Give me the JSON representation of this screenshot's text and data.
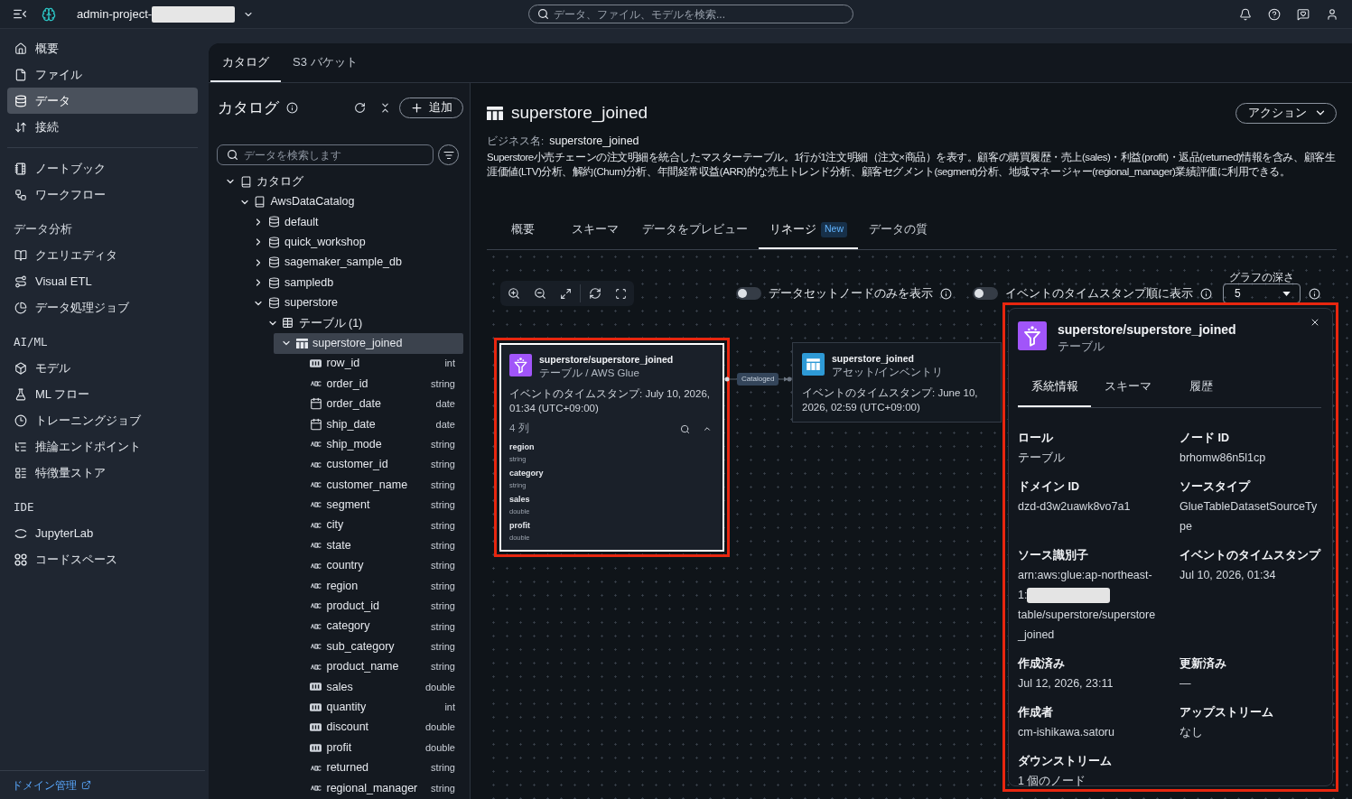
{
  "top_bar": {
    "project_name": "admin-project-",
    "project_name_redacted": true,
    "search": {
      "placeholder": "データ、ファイル、モデルを検索..."
    }
  },
  "sidebar": {
    "groups": [
      {
        "items": [
          {
            "label": "概要",
            "selected": false
          },
          {
            "label": "ファイル",
            "selected": false
          },
          {
            "label": "データ",
            "selected": true
          },
          {
            "label": "接続",
            "selected": false
          }
        ]
      },
      {
        "items": [
          {
            "label": "ノートブック",
            "selected": false
          },
          {
            "label": "ワークフロー",
            "selected": false
          }
        ]
      },
      {
        "heading": "データ分析",
        "items": [
          {
            "label": "クエリエディタ",
            "selected": false
          },
          {
            "label": "Visual ETL",
            "selected": false
          },
          {
            "label": "データ処理ジョブ",
            "selected": false
          }
        ]
      },
      {
        "heading": "AI/ML",
        "items": [
          {
            "label": "モデル",
            "selected": false
          },
          {
            "label": "ML フロー",
            "selected": false
          },
          {
            "label": "トレーニングジョブ",
            "selected": false
          },
          {
            "label": "推論エンドポイント",
            "selected": false
          },
          {
            "label": "特徴量ストア",
            "selected": false
          }
        ]
      },
      {
        "heading": "IDE",
        "items": [
          {
            "label": "JupyterLab",
            "selected": false
          },
          {
            "label": "コードスペース",
            "selected": false
          }
        ]
      }
    ],
    "footer_link": "ドメイン管理"
  },
  "main_tabs": [
    {
      "label": "カタログ",
      "selected": true
    },
    {
      "label": "S3 バケット",
      "selected": false
    }
  ],
  "catalog": {
    "title": "カタログ",
    "add_button": "追加",
    "search": {
      "placeholder": "データを検索します"
    },
    "tree": [
      {
        "label": "カタログ",
        "kind": "catalog",
        "expanded": true,
        "selected": false,
        "children": [
          {
            "label": "AwsDataCatalog",
            "kind": "catalog",
            "expanded": true,
            "selected": false,
            "children": [
              {
                "label": "default",
                "kind": "database",
                "expanded": false,
                "selected": false
              },
              {
                "label": "quick_workshop",
                "kind": "database",
                "expanded": false,
                "selected": false
              },
              {
                "label": "sagemaker_sample_db",
                "kind": "database",
                "expanded": false,
                "selected": false
              },
              {
                "label": "sampledb",
                "kind": "database",
                "expanded": false,
                "selected": false
              },
              {
                "label": "superstore",
                "kind": "database",
                "expanded": true,
                "selected": false,
                "children": [
                  {
                    "label": "テーブル (1)",
                    "kind": "folder",
                    "expanded": true,
                    "selected": false,
                    "children": [
                      {
                        "label": "superstore_joined",
                        "kind": "table",
                        "expanded": true,
                        "selected": true,
                        "children": [
                          {
                            "label": "row_id",
                            "kind": "number",
                            "data_type": "int",
                            "selected": false
                          },
                          {
                            "label": "order_id",
                            "kind": "text",
                            "data_type": "string",
                            "selected": false
                          },
                          {
                            "label": "order_date",
                            "kind": "date",
                            "data_type": "date",
                            "selected": false
                          },
                          {
                            "label": "ship_date",
                            "kind": "date",
                            "data_type": "date",
                            "selected": false
                          },
                          {
                            "label": "ship_mode",
                            "kind": "text",
                            "data_type": "string",
                            "selected": false
                          },
                          {
                            "label": "customer_id",
                            "kind": "text",
                            "data_type": "string",
                            "selected": false
                          },
                          {
                            "label": "customer_name",
                            "kind": "text",
                            "data_type": "string",
                            "selected": false
                          },
                          {
                            "label": "segment",
                            "kind": "text",
                            "data_type": "string",
                            "selected": false
                          },
                          {
                            "label": "city",
                            "kind": "text",
                            "data_type": "string",
                            "selected": false
                          },
                          {
                            "label": "state",
                            "kind": "text",
                            "data_type": "string",
                            "selected": false
                          },
                          {
                            "label": "country",
                            "kind": "text",
                            "data_type": "string",
                            "selected": false
                          },
                          {
                            "label": "region",
                            "kind": "text",
                            "data_type": "string",
                            "selected": false
                          },
                          {
                            "label": "product_id",
                            "kind": "text",
                            "data_type": "string",
                            "selected": false
                          },
                          {
                            "label": "category",
                            "kind": "text",
                            "data_type": "string",
                            "selected": false
                          },
                          {
                            "label": "sub_category",
                            "kind": "text",
                            "data_type": "string",
                            "selected": false
                          },
                          {
                            "label": "product_name",
                            "kind": "text",
                            "data_type": "string",
                            "selected": false
                          },
                          {
                            "label": "sales",
                            "kind": "number",
                            "data_type": "double",
                            "selected": false
                          },
                          {
                            "label": "quantity",
                            "kind": "number",
                            "data_type": "int",
                            "selected": false
                          },
                          {
                            "label": "discount",
                            "kind": "number",
                            "data_type": "double",
                            "selected": false
                          },
                          {
                            "label": "profit",
                            "kind": "number",
                            "data_type": "double",
                            "selected": false
                          },
                          {
                            "label": "returned",
                            "kind": "text",
                            "data_type": "string",
                            "selected": false
                          },
                          {
                            "label": "regional_manager",
                            "kind": "text",
                            "data_type": "string",
                            "selected": false
                          }
                        ]
                      }
                    ]
                  }
                ]
              }
            ]
          }
        ]
      }
    ]
  },
  "detail": {
    "title": "superstore_joined",
    "action_button": "アクション",
    "business_name_label": "ビジネス名:",
    "business_name": "superstore_joined",
    "description": "Superstore小売チェーンの注文明細を統合したマスターテーブル。1行が1注文明細（注文×商品）を表す。顧客の購買履歴・売上(sales)・利益(profit)・返品(returned)情報を含み、顧客生涯価値(LTV)分析、解約(Churn)分析、年間経常収益(ARR)的な売上トレンド分析、顧客セグメント(segment)分析、地域マネージャー(regional_manager)業績評価に利用できる。",
    "tabs": [
      {
        "label": "概要",
        "selected": false
      },
      {
        "label": "スキーマ",
        "selected": false
      },
      {
        "label": "データをプレビュー",
        "selected": false
      },
      {
        "label": "リネージ",
        "badge": "New",
        "selected": true
      },
      {
        "label": "データの質",
        "selected": false
      }
    ],
    "lineage": {
      "toggles": [
        {
          "label": "データセットノードのみを表示",
          "on": false
        },
        {
          "label": "イベントのタイムスタンプ順に表示",
          "on": false
        }
      ],
      "graph_depth": {
        "label": "グラフの深さ",
        "value": "5"
      },
      "nodes": [
        {
          "kind": "glue_table",
          "selected": true,
          "highlighted": true,
          "title": "superstore/superstore_joined",
          "subtitle": "テーブル / AWS Glue",
          "timestamp": "イベントのタイムスタンプ: July 10, 2026, 01:34",
          "timezone": "(UTC+09:00)",
          "column_count": "4 列",
          "columns_expanded": true,
          "columns": [
            {
              "name": "region",
              "type": "string"
            },
            {
              "name": "category",
              "type": "string"
            },
            {
              "name": "sales",
              "type": "double"
            },
            {
              "name": "profit",
              "type": "double"
            }
          ]
        },
        {
          "kind": "asset",
          "selected": false,
          "highlighted": false,
          "title": "superstore_joined",
          "subtitle": "アセット/インベントリ",
          "timestamp": "イベントのタイムスタンプ: June 10, 2026, 02:59",
          "timezone": "(UTC+09:00)"
        }
      ],
      "edges": [
        {
          "label": "Cataloged"
        }
      ],
      "details_panel": {
        "highlighted": true,
        "title": "superstore/superstore_joined",
        "subtitle": "テーブル",
        "tabs": [
          {
            "label": "系統情報",
            "selected": true
          },
          {
            "label": "スキーマ",
            "selected": false
          },
          {
            "label": "履歴",
            "selected": false
          }
        ],
        "fields": [
          {
            "label": "ロール",
            "value": "テーブル"
          },
          {
            "label": "ノード ID",
            "value": "brhomw86n5l1cp"
          },
          {
            "label": "ドメイン ID",
            "value": "dzd-d3w2uawk8vo7a1"
          },
          {
            "label": "ソースタイプ",
            "value": "GlueTableDatasetSourceType"
          },
          {
            "label": "ソース識別子",
            "value": "arn:aws:glue:ap-northeast-1:",
            "redacted": true,
            "value_after_redaction": "table/superstore/superstore_joined"
          },
          {
            "label": "イベントのタイムスタンプ",
            "value": "Jul 10, 2026, 01:34"
          },
          {
            "label": "作成済み",
            "value": "Jul 12, 2026, 23:11"
          },
          {
            "label": "更新済み",
            "value": "—"
          },
          {
            "label": "作成者",
            "value": "cm-ishikawa.satoru"
          },
          {
            "label": "アップストリーム",
            "value": "なし"
          },
          {
            "label": "ダウンストリーム",
            "value": "1 個のノード"
          }
        ]
      }
    }
  }
}
